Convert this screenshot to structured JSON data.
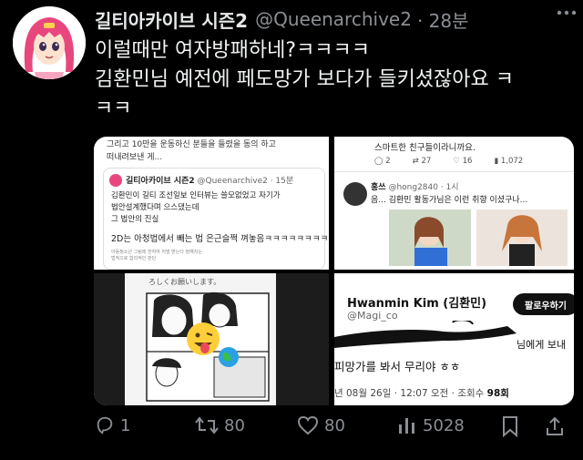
{
  "tweet": {
    "display_name": "길티아카이브 시즌2",
    "handle": "@Queenarchive2",
    "time": "· 28분",
    "more_icon": "more-dots-icon",
    "lines": [
      "이럴때만 여자방패하네?ㅋㅋㅋㅋ",
      "김환민님 예전에 페도망가 보다가 들키셨잖아요 ㅋ",
      "ㅋㅋ"
    ]
  },
  "media": {
    "q1": {
      "top_lines": [
        "그리고 10만을 운동하신 분들을 들렸을 동의 하고",
        "떠내려보낸 게..."
      ],
      "quote_name": "길티아카이브 시즌2",
      "quote_handle": "@Queenarchive2 · 15분",
      "quote_lines": [
        "김환민이 길티 조선일보 인터뷰는 쓸모없었고 자기가",
        "법안설계했다며 으스댔는데",
        "그 법안의 진실"
      ],
      "quote_line2d": "2D는 아청법에서 빼는 법 은근슬쩍 껴놓음ㅋㅋㅋㅋㅋㅋㅋㅋ",
      "tiny_lines": [
        "아동청소년 그림에 한하여 처벌 받는다 정해지는",
        "법적으로 합리적인 판단"
      ]
    },
    "q2": {
      "top_line": "스마트한 친구들이라니까요.",
      "stats": [
        "2",
        "27",
        "16",
        "1,072"
      ],
      "reply_name": "홍쓰",
      "reply_handle": "@hong2840 · 1시",
      "reply_text": "음... 김환민 활동가님은 이런 취향 이셨구나..."
    },
    "q3": {
      "caption_lines": [
        "ろしくお願いします。"
      ]
    },
    "q4": {
      "name": "Hwanmin Kim (김환민)",
      "handle": "@Magi_co",
      "follow_label": "팔로우하기",
      "side_text": "님에게 보내",
      "line_text": "피망가를 봐서 무리야 ㅎㅎ",
      "meta_text": "년 08월 26일 · 12:07 오전 · 조회수",
      "views": "98회"
    }
  },
  "actions": {
    "reply_count": "1",
    "retweet_count": "80",
    "like_count": "80",
    "views_count": "5028"
  },
  "colors": {
    "background": "#000000",
    "text": "#e7e9ea",
    "muted": "#8b8f94",
    "link_blue": "#1d9bf0"
  }
}
